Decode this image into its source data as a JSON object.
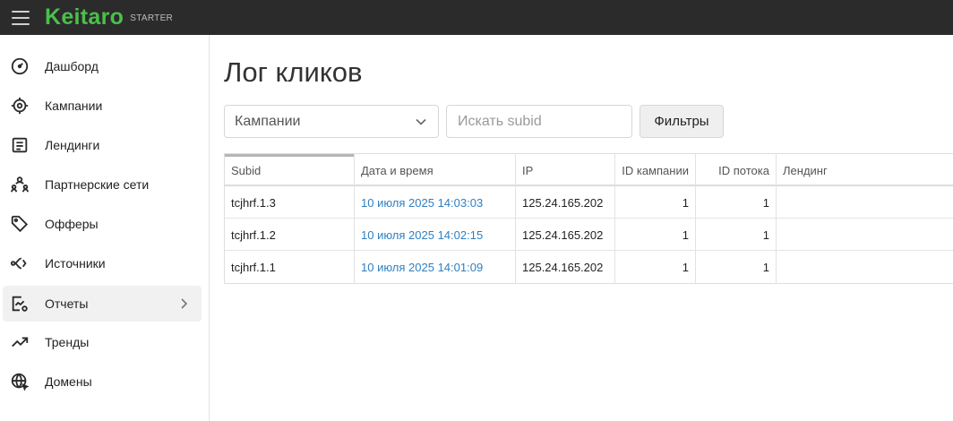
{
  "app": {
    "brand": "Keitaro",
    "plan": "STARTER"
  },
  "sidebar": {
    "items": [
      {
        "label": "Дашборд",
        "icon": "dashboard-icon"
      },
      {
        "label": "Кампании",
        "icon": "target-icon"
      },
      {
        "label": "Лендинги",
        "icon": "landing-page-icon"
      },
      {
        "label": "Партнерские сети",
        "icon": "partner-networks-icon"
      },
      {
        "label": "Офферы",
        "icon": "tag-icon"
      },
      {
        "label": "Источники",
        "icon": "source-icon"
      },
      {
        "label": "Отчеты",
        "icon": "reports-icon",
        "active": true
      },
      {
        "label": "Тренды",
        "icon": "trend-icon"
      },
      {
        "label": "Домены",
        "icon": "globe-icon"
      }
    ]
  },
  "page": {
    "title": "Лог кликов"
  },
  "toolbar": {
    "campaign_select": "Кампании",
    "search_placeholder": "Искать subid",
    "filters_label": "Фильтры"
  },
  "table": {
    "columns": [
      "Subid",
      "Дата и время",
      "IP",
      "ID кампании",
      "ID потока",
      "Лендинг"
    ],
    "rows": [
      {
        "subid": "tcjhrf.1.3",
        "datetime": "10 июля 2025 14:03:03",
        "ip": "125.24.165.202",
        "campaign_id": "1",
        "stream_id": "1",
        "landing": ""
      },
      {
        "subid": "tcjhrf.1.2",
        "datetime": "10 июля 2025 14:02:15",
        "ip": "125.24.165.202",
        "campaign_id": "1",
        "stream_id": "1",
        "landing": ""
      },
      {
        "subid": "tcjhrf.1.1",
        "datetime": "10 июля 2025 14:01:09",
        "ip": "125.24.165.202",
        "campaign_id": "1",
        "stream_id": "1",
        "landing": ""
      }
    ]
  },
  "colors": {
    "topbar": "#2b2b2b",
    "brand": "#4bbf4b",
    "link": "#2f7fc1",
    "active_item": "#f1f1f1"
  }
}
